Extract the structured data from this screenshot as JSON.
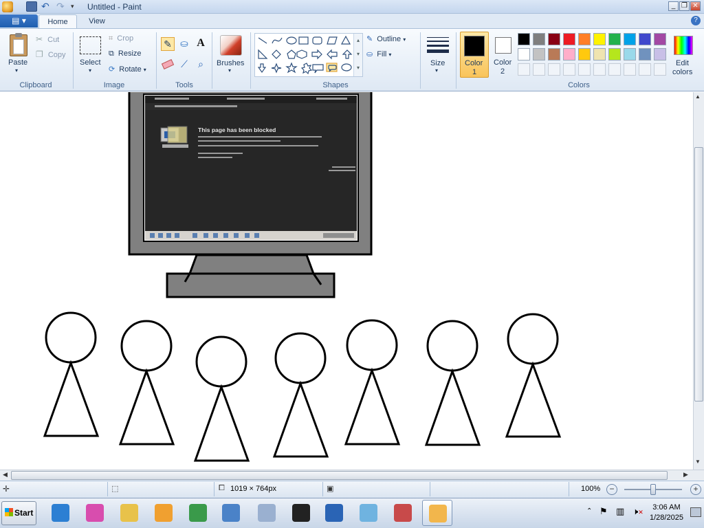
{
  "window": {
    "title": "Untitled - Paint",
    "min_icon": "minimize-icon",
    "max_icon": "restore-icon",
    "close_icon": "close-icon"
  },
  "menu": {
    "file_icon": "paint-menu-icon",
    "tabs": [
      "Home",
      "View"
    ],
    "help": "?"
  },
  "ribbon": {
    "clipboard": {
      "paste": "Paste",
      "cut": "Cut",
      "copy": "Copy",
      "label": "Clipboard"
    },
    "image": {
      "select": "Select",
      "crop": "Crop",
      "resize": "Resize",
      "rotate": "Rotate",
      "label": "Image"
    },
    "tools": {
      "label": "Tools",
      "items": [
        "pencil-icon",
        "fill-bucket-icon",
        "text-icon",
        "eraser-icon",
        "color-picker-icon",
        "magnifier-icon"
      ]
    },
    "brushes": {
      "label": "Brushes"
    },
    "shapes": {
      "label": "Shapes",
      "outline": "Outline",
      "fill": "Fill"
    },
    "size": {
      "label": "Size"
    },
    "color1": {
      "label1": "Color",
      "label2": "1",
      "value": "#000000"
    },
    "color2": {
      "label1": "Color",
      "label2": "2",
      "value": "#ffffff"
    },
    "colors": {
      "label": "Colors",
      "row1": [
        "#000000",
        "#7f7f7f",
        "#880015",
        "#ed1c24",
        "#ff7f27",
        "#fff200",
        "#22b14c",
        "#00a2e8",
        "#3f48cc",
        "#a349a4"
      ],
      "row2": [
        "#ffffff",
        "#c3c3c3",
        "#b97a57",
        "#ffaec9",
        "#ffc90e",
        "#efe4b0",
        "#b5e61d",
        "#99d9ea",
        "#7092be",
        "#c8bfe7"
      ]
    },
    "edit_colors": {
      "line1": "Edit",
      "line2": "colors"
    }
  },
  "embedded_screenshot": {
    "heading": "This page has been blocked"
  },
  "statusbar": {
    "dimensions": "1019 × 764px",
    "zoom": "100%",
    "zoom_level": 1.0
  },
  "taskbar": {
    "start": "Start",
    "apps": [
      "internet-explorer-icon",
      "fox-app-icon",
      "file-explorer-icon",
      "media-player-icon",
      "globe-app-icon",
      "network-app-icon",
      "cd-burner-icon",
      "7zip-icon",
      "file-transfer-icon",
      "notepad-icon",
      "snipping-tool-icon",
      "paint-icon"
    ],
    "time": "3:06 AM",
    "date": "1/28/2025"
  }
}
